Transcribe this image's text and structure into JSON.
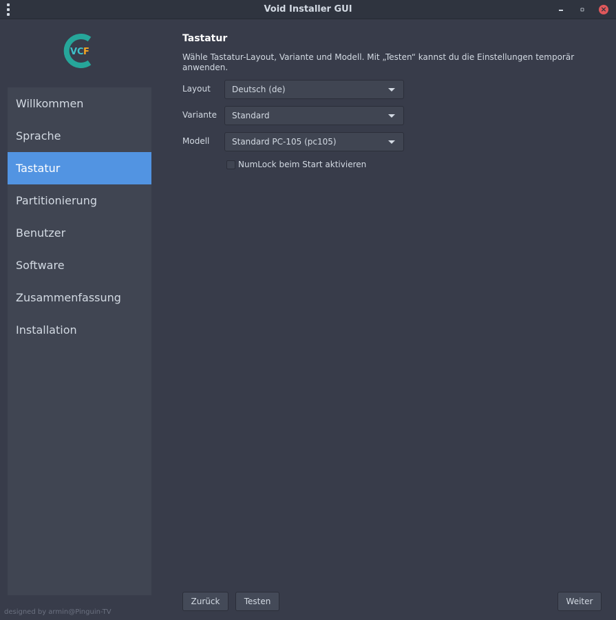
{
  "window": {
    "title": "Void Installer GUI",
    "accent_color": "#5294e2",
    "close_color": "#e0585b"
  },
  "logo": {
    "text_left": "VC",
    "text_right": "F",
    "ring_color": "#26a69a",
    "f_color": "#f5a623"
  },
  "sidebar": {
    "items": [
      {
        "label": "Willkommen",
        "active": false
      },
      {
        "label": "Sprache",
        "active": false
      },
      {
        "label": "Tastatur",
        "active": true
      },
      {
        "label": "Partitionierung",
        "active": false
      },
      {
        "label": "Benutzer",
        "active": false
      },
      {
        "label": "Software",
        "active": false
      },
      {
        "label": "Zusammenfassung",
        "active": false
      },
      {
        "label": "Installation",
        "active": false
      }
    ],
    "credit": "designed by armin@Pinguin-TV"
  },
  "page": {
    "title": "Tastatur",
    "description": "Wähle Tastatur-Layout, Variante und Modell. Mit „Testen“ kannst du die Einstellungen temporär anwenden.",
    "fields": {
      "layout": {
        "label": "Layout",
        "value": "Deutsch  (de)"
      },
      "variant": {
        "label": "Variante",
        "value": "Standard"
      },
      "model": {
        "label": "Modell",
        "value": "Standard PC-105  (pc105)"
      }
    },
    "numlock": {
      "label": "NumLock beim Start aktivieren",
      "checked": false
    }
  },
  "buttons": {
    "back": "Zurück",
    "test": "Testen",
    "next": "Weiter"
  }
}
